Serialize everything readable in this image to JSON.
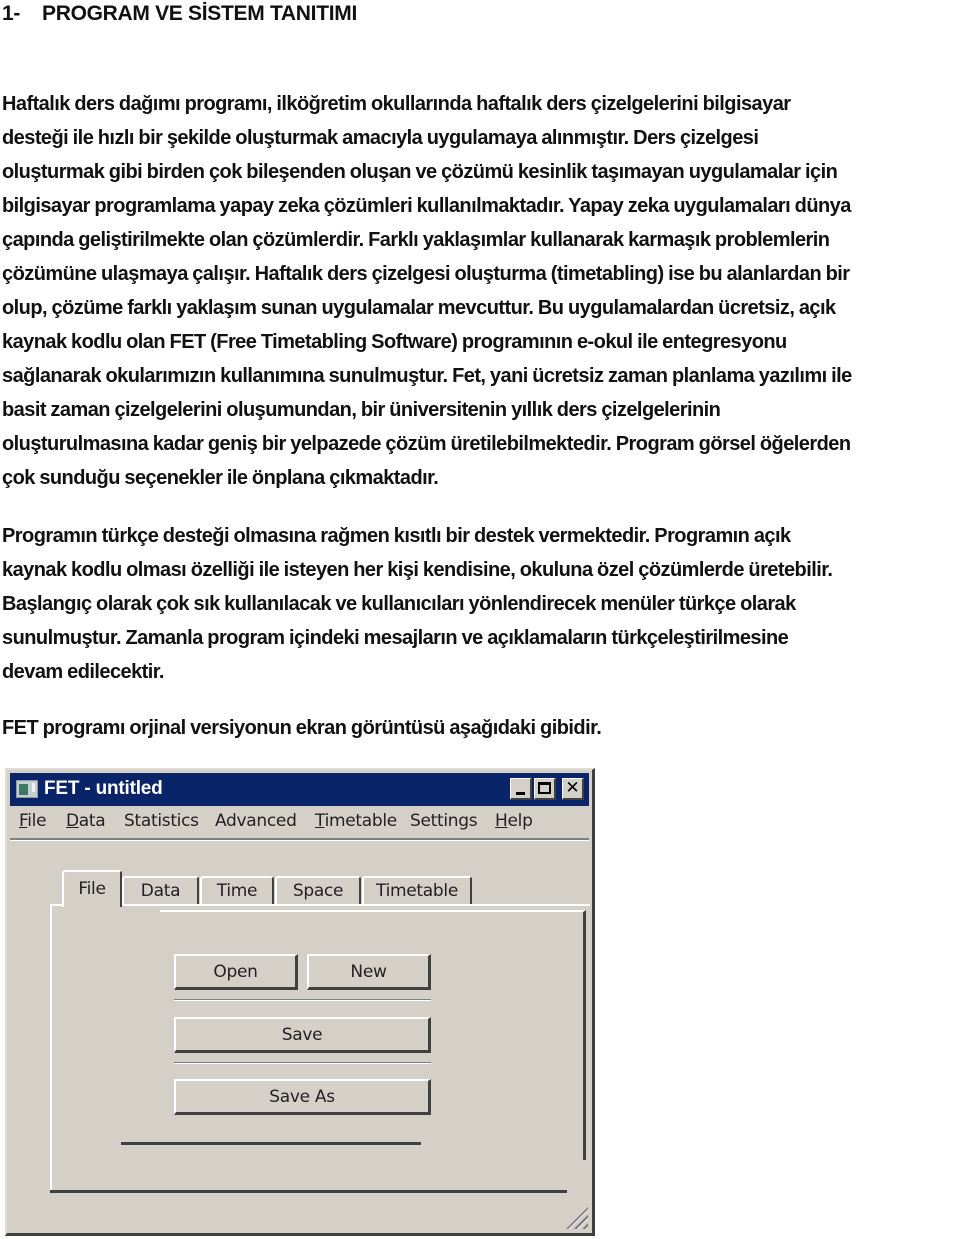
{
  "document": {
    "heading": {
      "number": "1-",
      "title": "PROGRAM VE SİSTEM TANITIMI"
    },
    "paragraphs": [
      {
        "lines": [
          "Haftalık ders dağımı programı, ilköğretim okullarında haftalık ders çizelgelerini bilgisayar",
          "desteği ile hızlı bir şekilde oluşturmak amacıyla uygulamaya alınmıştır. Ders çizelgesi",
          "oluşturmak gibi birden çok bileşenden oluşan ve çözümü kesinlik taşımayan uygulamalar için",
          "bilgisayar programlama yapay zeka çözümleri kullanılmaktadır. Yapay zeka uygulamaları dünya",
          "çapında geliştirilmekte olan çözümlerdir. Farklı yaklaşımlar kullanarak karmaşık problemlerin",
          "çözümüne ulaşmaya çalışır. Haftalık ders çizelgesi oluşturma (timetabling) ise bu alanlardan bir",
          "olup, çözüme farklı yaklaşım sunan uygulamalar mevcuttur. Bu uygulamalardan ücretsiz, açık",
          "kaynak kodlu olan FET (Free Timetabling Software) programının e-okul ile entegresyonu",
          "sağlanarak okularımızın kullanımına sunulmuştur. Fet, yani ücretsiz zaman planlama yazılımı ile",
          "basit zaman çizelgelerini oluşumundan, bir üniversitenin yıllık ders çizelgelerinin",
          "oluşturulmasına kadar geniş bir yelpazede çözüm üretilebilmektedir. Program görsel öğelerden",
          "çok sunduğu seçenekler ile önplana çıkmaktadır."
        ]
      },
      {
        "lines": [
          "Programın türkçe desteği olmasına rağmen kısıtlı bir destek vermektedir.  Programın açık",
          "kaynak kodlu olması özelliği ile isteyen her kişi kendisine, okuluna özel çözümlerde üretebilir.",
          "Başlangıç olarak çok sık kullanılacak ve kullanıcıları yönlendirecek menüler türkçe olarak",
          "sunulmuştur.  Zamanla program içindeki mesajların ve açıklamaların türkçeleştirilmesine",
          "devam edilecektir."
        ]
      },
      {
        "lines": [
          "FET programı orjinal versiyonun ekran görüntüsü aşağıdaki gibidir."
        ]
      }
    ]
  },
  "fet_window": {
    "title": "FET - untitled",
    "app_icon": "fet-app-icon",
    "caption_buttons": {
      "minimize": "minimize-icon",
      "maximize": "maximize-icon",
      "close": "close-icon",
      "close_glyph": "✕"
    },
    "menu": [
      {
        "pre": "",
        "accel": "F",
        "post": "ile"
      },
      {
        "pre": "",
        "accel": "D",
        "post": "ata"
      },
      {
        "pre": "Statistics",
        "accel": "",
        "post": ""
      },
      {
        "pre": "Advanced",
        "accel": "",
        "post": ""
      },
      {
        "pre": "",
        "accel": "T",
        "post": "imetable"
      },
      {
        "pre": "Settings",
        "accel": "",
        "post": ""
      },
      {
        "pre": "",
        "accel": "H",
        "post": "elp"
      }
    ],
    "tabs": [
      {
        "label": "File",
        "active": true
      },
      {
        "label": "Data",
        "active": false
      },
      {
        "label": "Time",
        "active": false
      },
      {
        "label": "Space",
        "active": false
      },
      {
        "label": "Timetable",
        "active": false
      }
    ],
    "file_tab": {
      "open_label": "Open",
      "new_label": "New",
      "save_label": "Save",
      "save_as_label": "Save As"
    }
  }
}
